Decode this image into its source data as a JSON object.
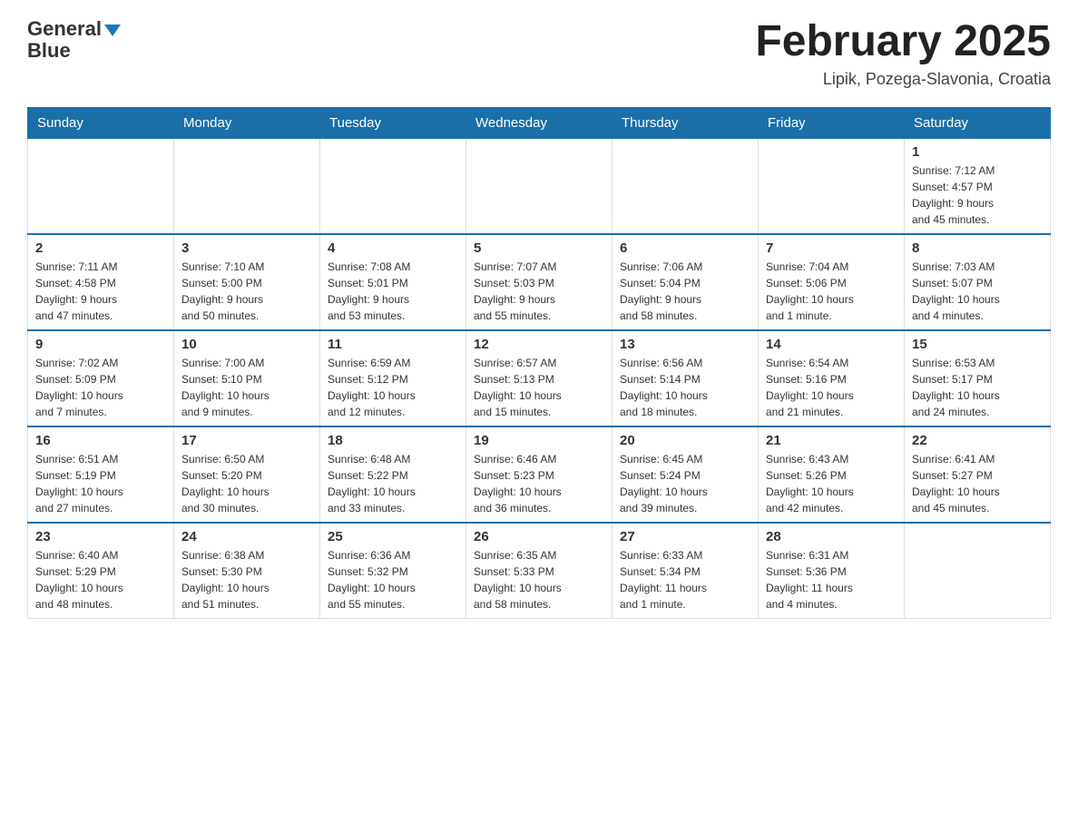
{
  "header": {
    "logo_line1": "General",
    "logo_line2": "Blue",
    "title": "February 2025",
    "subtitle": "Lipik, Pozega-Slavonia, Croatia"
  },
  "weekdays": [
    "Sunday",
    "Monday",
    "Tuesday",
    "Wednesday",
    "Thursday",
    "Friday",
    "Saturday"
  ],
  "weeks": [
    [
      {
        "day": "",
        "info": ""
      },
      {
        "day": "",
        "info": ""
      },
      {
        "day": "",
        "info": ""
      },
      {
        "day": "",
        "info": ""
      },
      {
        "day": "",
        "info": ""
      },
      {
        "day": "",
        "info": ""
      },
      {
        "day": "1",
        "info": "Sunrise: 7:12 AM\nSunset: 4:57 PM\nDaylight: 9 hours\nand 45 minutes."
      }
    ],
    [
      {
        "day": "2",
        "info": "Sunrise: 7:11 AM\nSunset: 4:58 PM\nDaylight: 9 hours\nand 47 minutes."
      },
      {
        "day": "3",
        "info": "Sunrise: 7:10 AM\nSunset: 5:00 PM\nDaylight: 9 hours\nand 50 minutes."
      },
      {
        "day": "4",
        "info": "Sunrise: 7:08 AM\nSunset: 5:01 PM\nDaylight: 9 hours\nand 53 minutes."
      },
      {
        "day": "5",
        "info": "Sunrise: 7:07 AM\nSunset: 5:03 PM\nDaylight: 9 hours\nand 55 minutes."
      },
      {
        "day": "6",
        "info": "Sunrise: 7:06 AM\nSunset: 5:04 PM\nDaylight: 9 hours\nand 58 minutes."
      },
      {
        "day": "7",
        "info": "Sunrise: 7:04 AM\nSunset: 5:06 PM\nDaylight: 10 hours\nand 1 minute."
      },
      {
        "day": "8",
        "info": "Sunrise: 7:03 AM\nSunset: 5:07 PM\nDaylight: 10 hours\nand 4 minutes."
      }
    ],
    [
      {
        "day": "9",
        "info": "Sunrise: 7:02 AM\nSunset: 5:09 PM\nDaylight: 10 hours\nand 7 minutes."
      },
      {
        "day": "10",
        "info": "Sunrise: 7:00 AM\nSunset: 5:10 PM\nDaylight: 10 hours\nand 9 minutes."
      },
      {
        "day": "11",
        "info": "Sunrise: 6:59 AM\nSunset: 5:12 PM\nDaylight: 10 hours\nand 12 minutes."
      },
      {
        "day": "12",
        "info": "Sunrise: 6:57 AM\nSunset: 5:13 PM\nDaylight: 10 hours\nand 15 minutes."
      },
      {
        "day": "13",
        "info": "Sunrise: 6:56 AM\nSunset: 5:14 PM\nDaylight: 10 hours\nand 18 minutes."
      },
      {
        "day": "14",
        "info": "Sunrise: 6:54 AM\nSunset: 5:16 PM\nDaylight: 10 hours\nand 21 minutes."
      },
      {
        "day": "15",
        "info": "Sunrise: 6:53 AM\nSunset: 5:17 PM\nDaylight: 10 hours\nand 24 minutes."
      }
    ],
    [
      {
        "day": "16",
        "info": "Sunrise: 6:51 AM\nSunset: 5:19 PM\nDaylight: 10 hours\nand 27 minutes."
      },
      {
        "day": "17",
        "info": "Sunrise: 6:50 AM\nSunset: 5:20 PM\nDaylight: 10 hours\nand 30 minutes."
      },
      {
        "day": "18",
        "info": "Sunrise: 6:48 AM\nSunset: 5:22 PM\nDaylight: 10 hours\nand 33 minutes."
      },
      {
        "day": "19",
        "info": "Sunrise: 6:46 AM\nSunset: 5:23 PM\nDaylight: 10 hours\nand 36 minutes."
      },
      {
        "day": "20",
        "info": "Sunrise: 6:45 AM\nSunset: 5:24 PM\nDaylight: 10 hours\nand 39 minutes."
      },
      {
        "day": "21",
        "info": "Sunrise: 6:43 AM\nSunset: 5:26 PM\nDaylight: 10 hours\nand 42 minutes."
      },
      {
        "day": "22",
        "info": "Sunrise: 6:41 AM\nSunset: 5:27 PM\nDaylight: 10 hours\nand 45 minutes."
      }
    ],
    [
      {
        "day": "23",
        "info": "Sunrise: 6:40 AM\nSunset: 5:29 PM\nDaylight: 10 hours\nand 48 minutes."
      },
      {
        "day": "24",
        "info": "Sunrise: 6:38 AM\nSunset: 5:30 PM\nDaylight: 10 hours\nand 51 minutes."
      },
      {
        "day": "25",
        "info": "Sunrise: 6:36 AM\nSunset: 5:32 PM\nDaylight: 10 hours\nand 55 minutes."
      },
      {
        "day": "26",
        "info": "Sunrise: 6:35 AM\nSunset: 5:33 PM\nDaylight: 10 hours\nand 58 minutes."
      },
      {
        "day": "27",
        "info": "Sunrise: 6:33 AM\nSunset: 5:34 PM\nDaylight: 11 hours\nand 1 minute."
      },
      {
        "day": "28",
        "info": "Sunrise: 6:31 AM\nSunset: 5:36 PM\nDaylight: 11 hours\nand 4 minutes."
      },
      {
        "day": "",
        "info": ""
      }
    ]
  ]
}
